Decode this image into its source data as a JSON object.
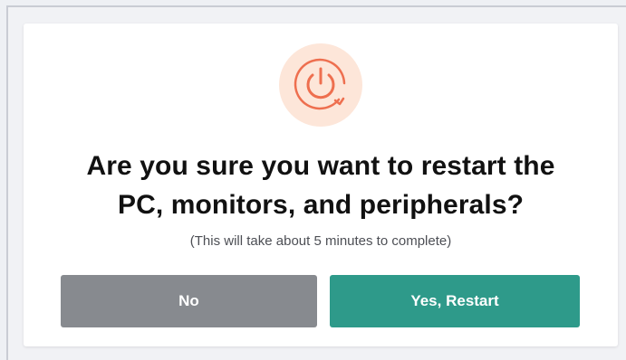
{
  "dialog": {
    "icon": "power-restart-icon",
    "title_line1": "Are you sure you want to restart the",
    "title_line2": "PC, monitors, and peripherals?",
    "subtitle": "(This will take about 5 minutes to complete)",
    "buttons": {
      "no_label": "No",
      "yes_label": "Yes, Restart"
    }
  },
  "colors": {
    "icon_bg": "#fde6d9",
    "icon_stroke": "#ee6f4f",
    "no_button": "#878a8f",
    "yes_button": "#2e9a8a"
  }
}
